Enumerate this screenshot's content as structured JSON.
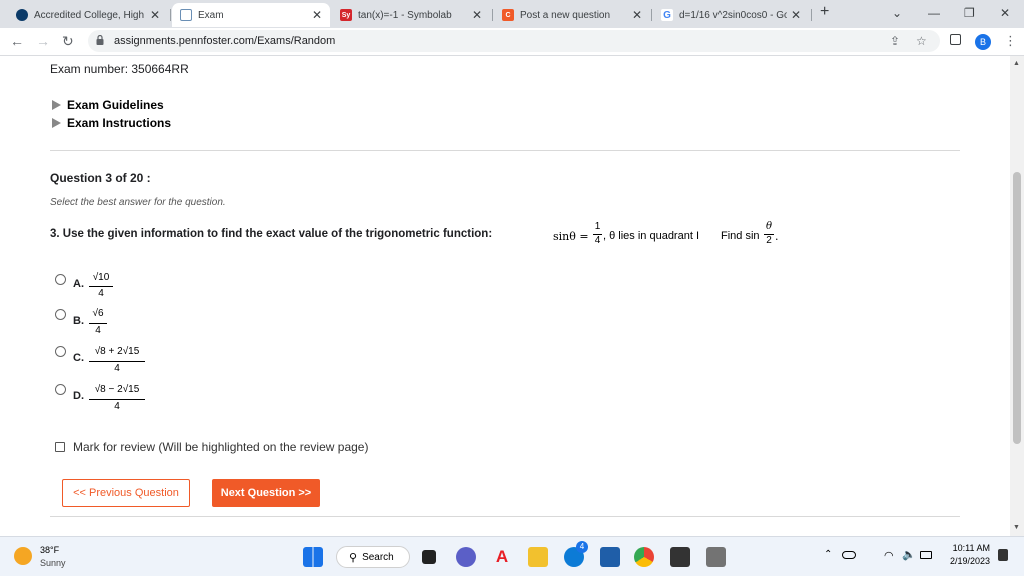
{
  "browser": {
    "tabs": [
      {
        "title": "Accredited College, High",
        "favicon_color": "#0b3a68"
      },
      {
        "title": "Exam",
        "favicon_color": "#6a8fb5"
      },
      {
        "title": "tan(x)=-1 - Symbolab",
        "favicon_color": "#d4262c",
        "favicon_text": "Sy"
      },
      {
        "title": "Post a new question",
        "favicon_color": "#f05a28",
        "favicon_text": "C"
      },
      {
        "title": "d=1/16 v^2sin0cos0 - Go",
        "favicon_color": "#4285f4",
        "favicon_text": "G"
      }
    ],
    "new_tab": "+",
    "url": "assignments.pennfoster.com/Exams/Random",
    "profile_initial": "B"
  },
  "exam": {
    "number_label": "Exam number: 350664RR",
    "guidelines": "Exam Guidelines",
    "instructions": "Exam Instructions",
    "question_header": "Question 3 of 20 :",
    "select_hint": "Select the best answer for the question.",
    "question_text": "3.   Use the given information to find the exact value of the trigonometric function:",
    "math": {
      "given_lhs": "sinθ =",
      "given_num": "1",
      "given_den": "4",
      "given_tail": ", θ lies in quadrant I",
      "find": "Find sin",
      "find_num": "θ",
      "find_den": "2",
      "find_end": "."
    },
    "options": [
      {
        "letter": "A.",
        "numerator": "√10",
        "denominator": "4"
      },
      {
        "letter": "B.",
        "numerator": "√6",
        "denominator": "4"
      },
      {
        "letter": "C.",
        "numerator": "√8 + 2√15",
        "denominator": "4"
      },
      {
        "letter": "D.",
        "numerator": "√8 − 2√15",
        "denominator": "4"
      }
    ],
    "review_label": "Mark for review (Will be highlighted on the review page)",
    "prev_button": "<< Previous Question",
    "next_button": "Next Question >>",
    "accent_color": "#f05a28"
  },
  "taskbar": {
    "weather_temp": "38°F",
    "weather_desc": "Sunny",
    "search_label": "Search",
    "time": "10:11 AM",
    "date": "2/19/2023",
    "badge": "4"
  }
}
